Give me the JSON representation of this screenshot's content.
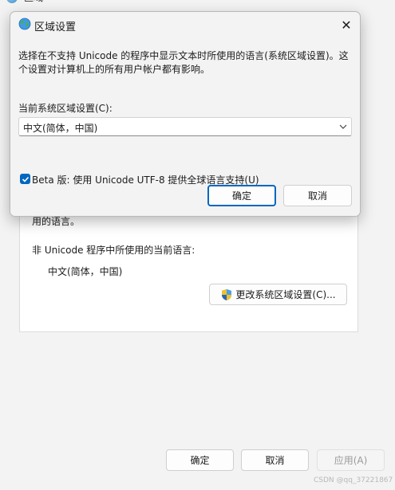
{
  "background_window": {
    "title": "区域",
    "close_glyph": "✕",
    "panel_text_tail": "用的语言。",
    "non_unicode_label": "非 Unicode 程序中所使用的当前语言:",
    "non_unicode_value": "中文(简体，中国)",
    "change_locale_button": "更改系统区域设置(C)...",
    "ok_button": "确定",
    "cancel_button": "取消",
    "apply_button": "应用(A)",
    "watermark": "CSDN @qq_37221867"
  },
  "dialog": {
    "title": "区域设置",
    "close_glyph": "✕",
    "description": "选择在不支持 Unicode 的程序中显示文本时所使用的语言(系统区域设置)。这个设置对计算机上的所有用户帐户都有影响。",
    "locale_label": "当前系统区域设置(C):",
    "locale_selected": "中文(简体，中国)",
    "beta_checkbox_label": "Beta 版: 使用 Unicode UTF-8 提供全球语言支持(U)",
    "beta_checked": true,
    "ok_button": "确定",
    "cancel_button": "取消"
  },
  "icons": {
    "dialog_icon": "globe-icon",
    "change_button_icon": "uac-shield-icon",
    "select_icon": "chevron-down-icon",
    "checkbox_icon": "checkmark-icon"
  },
  "colors": {
    "accent": "#0067c0",
    "window_bg": "#f3f3f3",
    "panel_bg": "#ffffff"
  }
}
